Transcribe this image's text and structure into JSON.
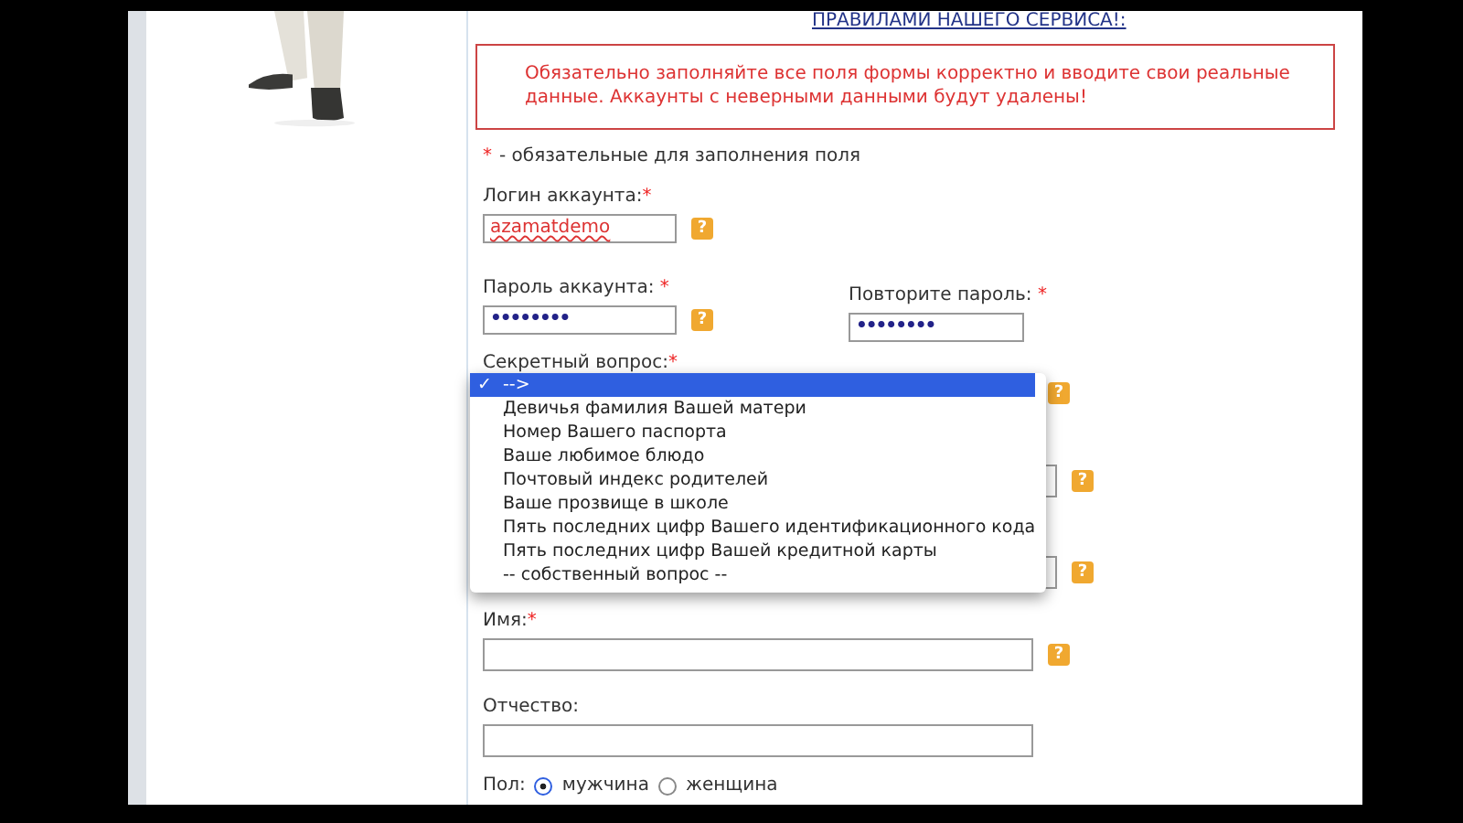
{
  "rules_link": "ПРАВИЛАМИ НАШЕГО СЕРВИСА!:",
  "notice": "Обязательно заполняйте все поля формы корректно и вводите свои реальные данные. Аккаунты с неверными данными будут удалены!",
  "legend": {
    "mark": "*",
    "text": "- обязательные для заполнения поля"
  },
  "login": {
    "label": "Логин аккаунта:",
    "required": true,
    "value": "azamatdemo",
    "help": "?"
  },
  "password": {
    "label": "Пароль аккаунта:",
    "required": true,
    "value": "••••••••",
    "help": "?"
  },
  "password_repeat": {
    "label": "Повторите пароль:",
    "required": true,
    "value": "••••••••"
  },
  "secret_question": {
    "label": "Секретный вопрос:",
    "required": true,
    "help": "?",
    "expanded": true,
    "check": "✓",
    "options": [
      {
        "label": "-->",
        "selected": true
      },
      {
        "label": "Девичья фамилия Вашей матери",
        "selected": false
      },
      {
        "label": "Номер Вашего паспорта",
        "selected": false
      },
      {
        "label": "Ваше любимое блюдо",
        "selected": false
      },
      {
        "label": "Почтовый индекс родителей",
        "selected": false
      },
      {
        "label": "Ваше прозвище в школе",
        "selected": false
      },
      {
        "label": "Пять последних цифр Вашего идентификационного кода",
        "selected": false
      },
      {
        "label": "Пять последних цифр Вашей кредитной карты",
        "selected": false
      },
      {
        "label": "-- собственный вопрос --",
        "selected": false
      }
    ]
  },
  "covered_fields": [
    {
      "help": "?"
    },
    {
      "help": "?"
    }
  ],
  "first_name": {
    "label": "Имя:",
    "required": true,
    "help": "?"
  },
  "patronymic": {
    "label": "Отчество:",
    "required": false
  },
  "gender": {
    "label": "Пол:",
    "options": [
      {
        "label": "мужчина",
        "selected": true
      },
      {
        "label": "женщина",
        "selected": false
      }
    ]
  }
}
